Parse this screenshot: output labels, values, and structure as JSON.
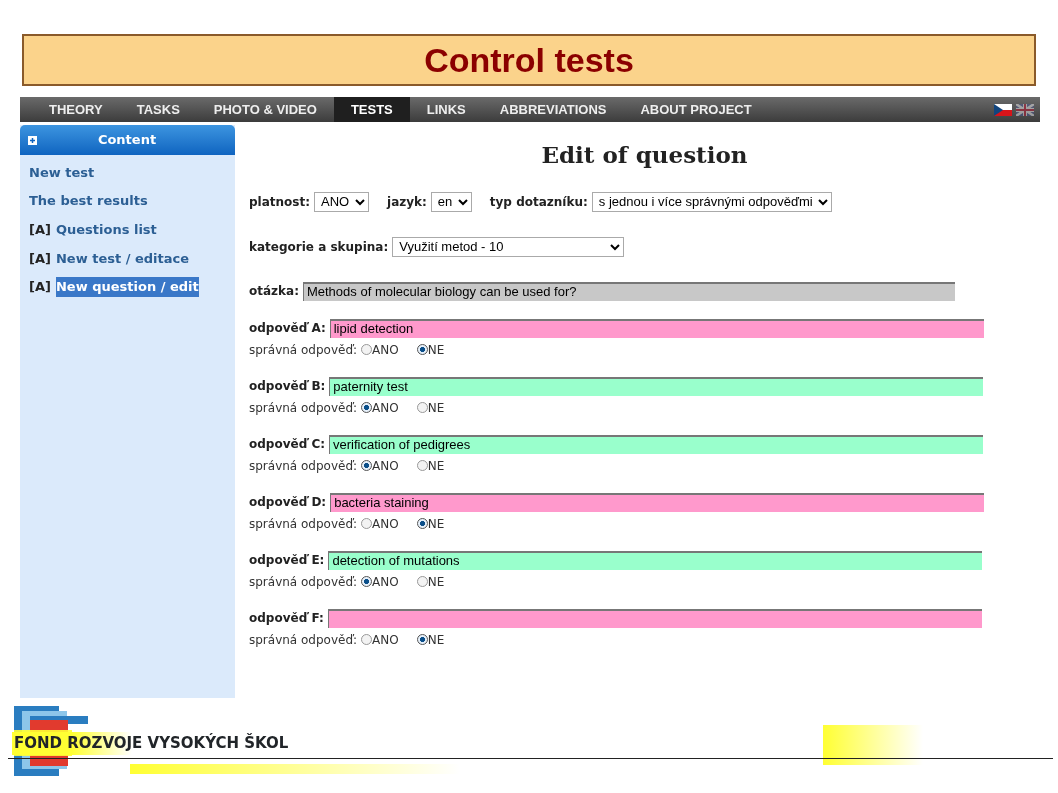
{
  "slide_title": "Control tests",
  "nav": [
    {
      "label": "THEORY",
      "selected": false
    },
    {
      "label": "TASKS",
      "selected": false
    },
    {
      "label": "PHOTO & VIDEO",
      "selected": false
    },
    {
      "label": "TESTS",
      "selected": true
    },
    {
      "label": "LINKS",
      "selected": false
    },
    {
      "label": "ABBREVIATIONS",
      "selected": false
    },
    {
      "label": "ABOUT PROJECT",
      "selected": false
    }
  ],
  "sidebar": {
    "header": "Content",
    "items": [
      {
        "label": "New test",
        "selected": false
      },
      {
        "label": "The best results",
        "selected": false
      },
      {
        "prefix": "[A]",
        "label": "Questions list",
        "selected": false
      },
      {
        "prefix": "[A]",
        "label": "New test / editace",
        "selected": false
      },
      {
        "prefix": "[A]",
        "label": "New question / edit",
        "selected": true
      }
    ]
  },
  "heading": "Edit of question",
  "filters": [
    {
      "label": "platnost:",
      "value": "ANO"
    },
    {
      "label": "jazyk:",
      "value": "en"
    },
    {
      "label": "typ dotazníku:",
      "value": "s jednou i více správnými odpověďmi"
    }
  ],
  "category": {
    "label": "kategorie a skupina:",
    "value": "Využití metod - 10"
  },
  "question": {
    "label": "otázka:",
    "value": "Methods of molecular biology can be used for?"
  },
  "answers": [
    {
      "label": "odpověď A:",
      "value": "lipid detection",
      "correct_label": "správná odpověď:",
      "options": [
        {
          "label": "ANO",
          "selected": false
        },
        {
          "label": "NE",
          "selected": true
        }
      ]
    },
    {
      "label": "odpověď B:",
      "value": "paternity test",
      "correct_label": "správná odpověď:",
      "options": [
        {
          "label": "ANO",
          "selected": true
        },
        {
          "label": "NE",
          "selected": false
        }
      ]
    },
    {
      "label": "odpověď C:",
      "value": "verification of pedigrees",
      "correct_label": "správná odpověď:",
      "options": [
        {
          "label": "ANO",
          "selected": true
        },
        {
          "label": "NE",
          "selected": false
        }
      ]
    },
    {
      "label": "odpověď D:",
      "value": "bacteria staining",
      "correct_label": "správná odpověď:",
      "options": [
        {
          "label": "ANO",
          "selected": false
        },
        {
          "label": "NE",
          "selected": true
        }
      ]
    },
    {
      "label": "odpověď E:",
      "value": "detection of mutations",
      "correct_label": "správná odpověď:",
      "options": [
        {
          "label": "ANO",
          "selected": true
        },
        {
          "label": "NE",
          "selected": false
        }
      ]
    },
    {
      "label": "odpověď F:",
      "correct_label": "správná odpověď:",
      "options": [
        {
          "label": "ANO",
          "selected": false
        },
        {
          "label": "NE",
          "selected": true
        }
      ]
    }
  ],
  "footer": {
    "text": "FOND ROZVOJE VYSOKÝCH ŠKOL"
  }
}
